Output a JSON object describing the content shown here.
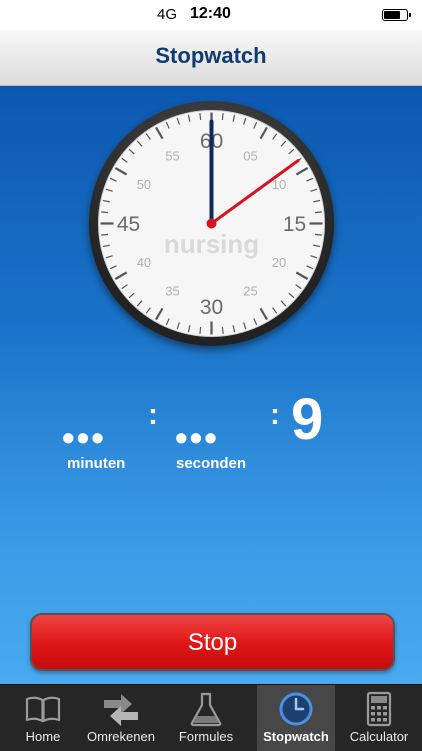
{
  "status_bar": {
    "network": "4G",
    "time": "12:40"
  },
  "nav": {
    "title": "Stopwatch"
  },
  "clock": {
    "logo": "nursing",
    "outer_numbers": [
      "60",
      "15",
      "30",
      "45"
    ],
    "inner_numbers": [
      "05",
      "10",
      "20",
      "25",
      "35",
      "40",
      "50",
      "55"
    ],
    "minute_hand_value": 0,
    "second_hand_value": 9
  },
  "timer": {
    "minutes_dots": "•••",
    "seconds_dots": "•••",
    "separator": ":",
    "digit": "9",
    "minutes_label": "minuten",
    "seconds_label": "seconden"
  },
  "stop_button": {
    "label": "Stop"
  },
  "tabs": [
    {
      "label": "Home",
      "icon": "book-icon",
      "active": false
    },
    {
      "label": "Omrekenen",
      "icon": "convert-arrows-icon",
      "active": false
    },
    {
      "label": "Formules",
      "icon": "flask-icon",
      "active": false
    },
    {
      "label": "Stopwatch",
      "icon": "clock-icon",
      "active": true
    },
    {
      "label": "Calculator",
      "icon": "calculator-icon",
      "active": false
    }
  ],
  "colors": {
    "nav_title": "#0f3b72",
    "background_top": "#0c58b0",
    "background_bottom": "#4aaaf0",
    "stop_button": "#e01818",
    "minute_hand": "#0f2a5a",
    "second_hand": "#d8131f",
    "tab_bar": "#262626"
  }
}
